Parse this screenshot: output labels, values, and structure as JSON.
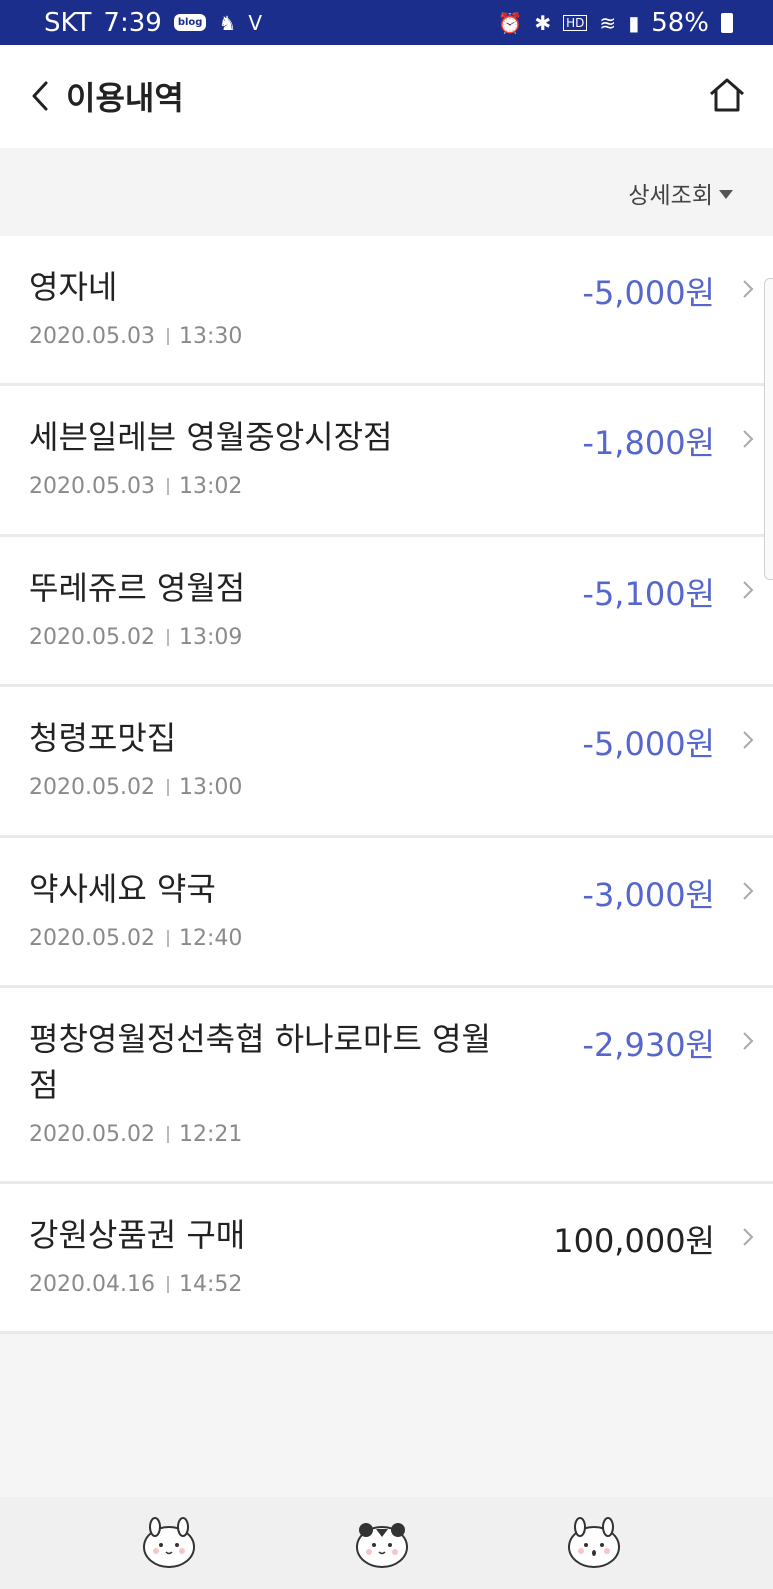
{
  "status_bar": {
    "carrier": "SKT",
    "time": "7:39",
    "blog_badge": "blog",
    "hd_label": "HD",
    "battery": "58%"
  },
  "header": {
    "title": "이용내역"
  },
  "filter": {
    "label": "상세조회"
  },
  "transactions": [
    {
      "name": "영자네",
      "amount": "-5,000원",
      "date": "2020.05.03",
      "time": "13:30"
    },
    {
      "name": "세븐일레븐 영월중앙시장점",
      "amount": "-1,800원",
      "date": "2020.05.03",
      "time": "13:02"
    },
    {
      "name": "뚜레쥬르 영월점",
      "amount": "-5,100원",
      "date": "2020.05.02",
      "time": "13:09"
    },
    {
      "name": "청령포맛집",
      "amount": "-5,000원",
      "date": "2020.05.02",
      "time": "13:00"
    },
    {
      "name": "약사세요 약국",
      "amount": "-3,000원",
      "date": "2020.05.02",
      "time": "12:40"
    },
    {
      "name": "평창영월정선축협 하나로마트 영월점",
      "amount": "-2,930원",
      "date": "2020.05.02",
      "time": "12:21"
    },
    {
      "name": "강원상품권 구매",
      "amount": "100,000원",
      "date": "2020.04.16",
      "time": "14:52"
    }
  ],
  "colors": {
    "status_bar": "#1c2e8c",
    "negative_amount": "#5566cc",
    "positive_amount": "#222222"
  }
}
